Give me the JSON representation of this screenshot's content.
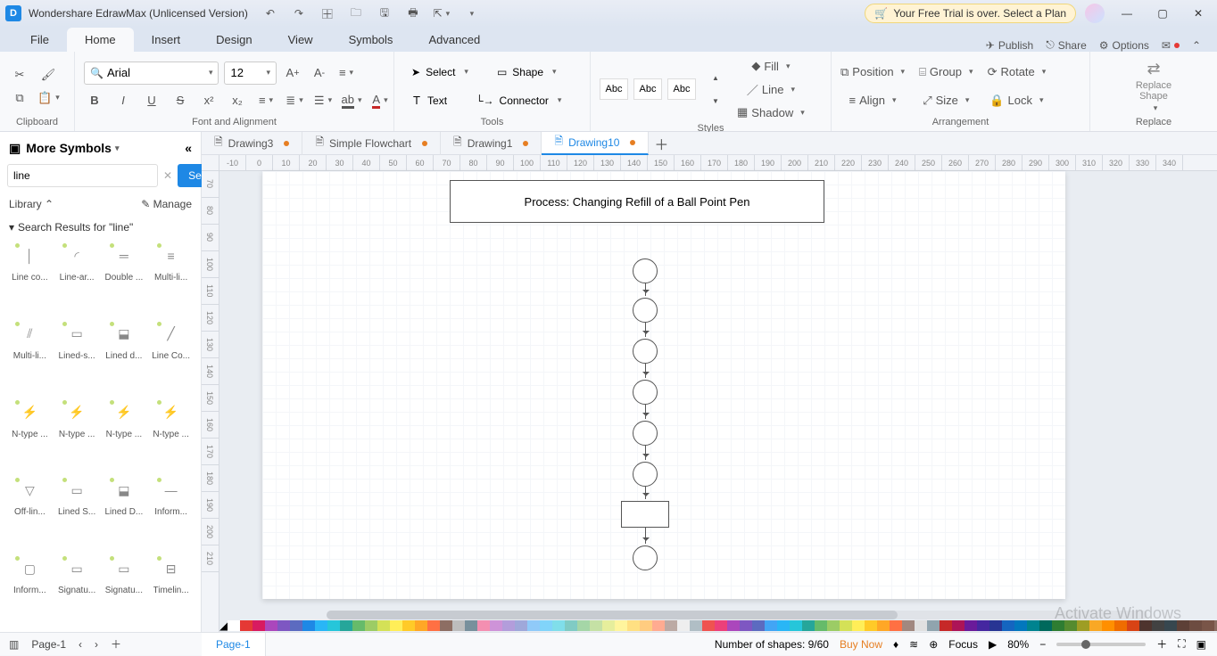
{
  "app": {
    "title": "Wondershare EdrawMax (Unlicensed Version)",
    "trial_banner": "Your Free Trial is over. Select a Plan"
  },
  "menu": {
    "file": "File",
    "tabs": [
      "Home",
      "Insert",
      "Design",
      "View",
      "Symbols",
      "Advanced"
    ],
    "active_index": 0,
    "publish": "Publish",
    "share": "Share",
    "options": "Options"
  },
  "ribbon": {
    "clipboard_label": "Clipboard",
    "font_label": "Font and Alignment",
    "tools_label": "Tools",
    "styles_label": "Styles",
    "arrangement_label": "Arrangement",
    "replace_label": "Replace",
    "font_name": "Arial",
    "font_size": "12",
    "select": "Select",
    "shape": "Shape",
    "text": "Text",
    "connector": "Connector",
    "abc": "Abc",
    "fill": "Fill",
    "line": "Line",
    "shadow": "Shadow",
    "position": "Position",
    "align": "Align",
    "group": "Group",
    "size": "Size",
    "rotate": "Rotate",
    "lock": "Lock",
    "replace_shape": "Replace\nShape"
  },
  "left_panel": {
    "title": "More Symbols",
    "search_value": "line",
    "search_btn": "Search",
    "library": "Library",
    "manage": "Manage",
    "results_head": "Search Results for  \"line\"",
    "shapes": [
      "Line co...",
      "Line-ar...",
      "Double ...",
      "Multi-li...",
      "Multi-li...",
      "Lined-s...",
      "Lined d...",
      "Line Co...",
      "N-type ...",
      "N-type ...",
      "N-type ...",
      "N-type ...",
      "Off-lin...",
      "Lined S...",
      "Lined D...",
      "Inform...",
      "Inform...",
      "Signatu...",
      "Signatu...",
      "Timelin..."
    ]
  },
  "doc_tabs": [
    {
      "name": "Drawing3",
      "dirty": true,
      "active": false
    },
    {
      "name": "Simple Flowchart",
      "dirty": true,
      "active": false
    },
    {
      "name": "Drawing1",
      "dirty": true,
      "active": false
    },
    {
      "name": "Drawing10",
      "dirty": true,
      "active": true
    }
  ],
  "canvas": {
    "process_title": "Process: Changing Refill of a Ball Point Pen",
    "watermark": "Activate Windows"
  },
  "ruler_h": [
    "-10",
    "0",
    "10",
    "20",
    "30",
    "40",
    "50",
    "60",
    "70",
    "80",
    "90",
    "100",
    "110",
    "120",
    "130",
    "140",
    "150",
    "160",
    "170",
    "180",
    "190",
    "200",
    "210",
    "220",
    "230",
    "240",
    "250",
    "260",
    "270",
    "280",
    "290",
    "300",
    "310",
    "320",
    "330",
    "340"
  ],
  "ruler_v": [
    "70",
    "80",
    "90",
    "100",
    "110",
    "120",
    "130",
    "140",
    "150",
    "160",
    "170",
    "180",
    "190",
    "200",
    "210"
  ],
  "colors": [
    "#fff",
    "#e53935",
    "#d81b60",
    "#ab47bc",
    "#7e57c2",
    "#5c6bc0",
    "#1e88e5",
    "#29b6f6",
    "#26c6da",
    "#26a69a",
    "#66bb6a",
    "#9ccc65",
    "#d4e157",
    "#ffee58",
    "#ffca28",
    "#ffa726",
    "#ff7043",
    "#8d6e63",
    "#bdbdbd",
    "#78909c",
    "#f48fb1",
    "#ce93d8",
    "#b39ddb",
    "#9fa8da",
    "#90caf9",
    "#81d4fa",
    "#80deea",
    "#80cbc4",
    "#a5d6a7",
    "#c5e1a5",
    "#e6ee9c",
    "#fff59d",
    "#ffe082",
    "#ffcc80",
    "#ffab91",
    "#bcaaa4",
    "#eeeeee",
    "#b0bec5",
    "#ef5350",
    "#ec407a",
    "#ab47bc",
    "#7e57c2",
    "#5c6bc0",
    "#42a5f5",
    "#29b6f6",
    "#26c6da",
    "#26a69a",
    "#66bb6a",
    "#9ccc65",
    "#d4e157",
    "#ffee58",
    "#ffca28",
    "#ffa726",
    "#ff7043",
    "#a1887f",
    "#e0e0e0",
    "#90a4ae",
    "#c62828",
    "#ad1457",
    "#6a1b9a",
    "#4527a0",
    "#283593",
    "#1565c0",
    "#0277bd",
    "#00838f",
    "#00695c",
    "#2e7d32",
    "#558b2f",
    "#9e9d24",
    "#f9a825",
    "#ff8f00",
    "#ef6c00",
    "#d84315",
    "#4e342e",
    "#424242",
    "#37474f",
    "#5d4037",
    "#6d4c41",
    "#795548",
    "#8d6e63"
  ],
  "page_tabs": {
    "current": "Page-1",
    "bottom_tab": "Page-1"
  },
  "status": {
    "shapes": "Number of shapes: 9/60",
    "buy_now": "Buy Now",
    "focus": "Focus",
    "zoom": "80%"
  }
}
